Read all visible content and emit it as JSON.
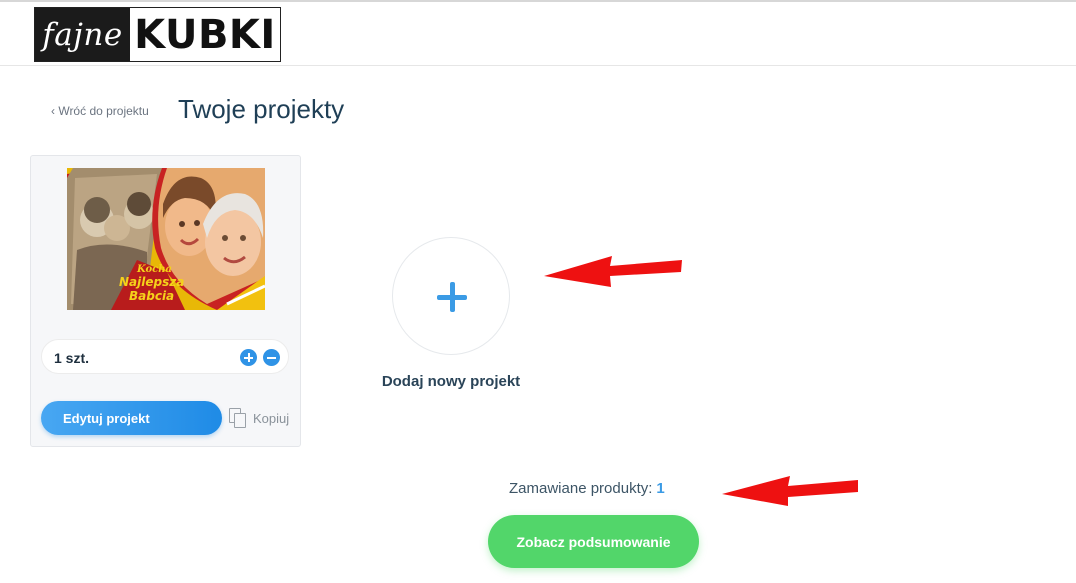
{
  "header": {
    "logo_script": "fajne",
    "logo_bold": "KUBKI"
  },
  "nav": {
    "back_label": "‹ Wróć do projektu",
    "page_title": "Twoje projekty"
  },
  "project_card": {
    "thumbnail_caption_line1": "Kocha",
    "thumbnail_caption_line2": "Najlepsza",
    "thumbnail_caption_line3": "Babcia",
    "quantity_label": "1 szt.",
    "edit_label": "Edytuj projekt",
    "copy_label": "Kopiuj"
  },
  "add_project": {
    "label": "Dodaj nowy projekt"
  },
  "footer": {
    "ordered_label": "Zamawiane produkty:",
    "ordered_count": "1",
    "summary_label": "Zobacz podsumowanie"
  },
  "colors": {
    "accent_blue": "#2f93e6",
    "summary_green": "#52d66a",
    "annotation_red": "#ee1111"
  }
}
